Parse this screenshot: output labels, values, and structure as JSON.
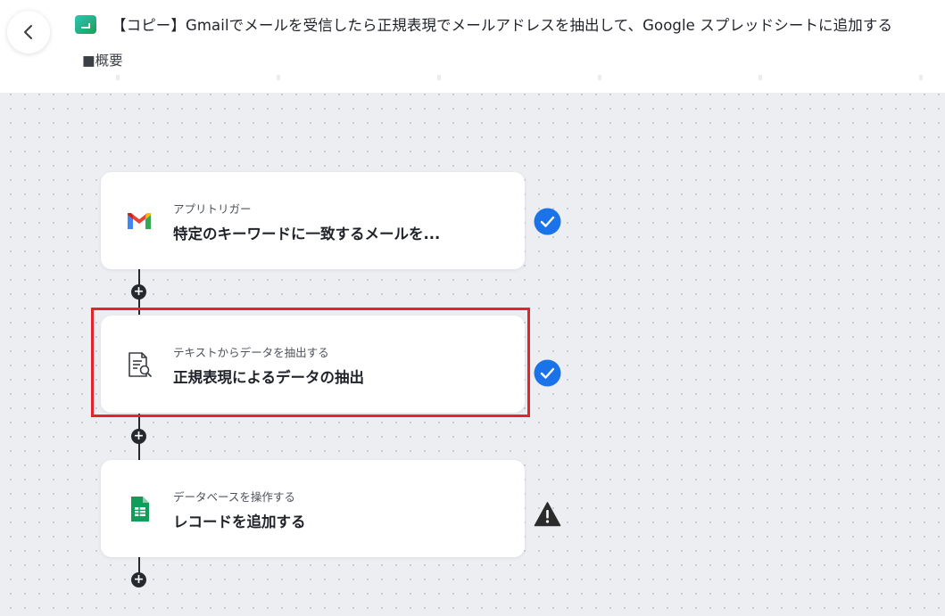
{
  "header": {
    "title": "【コピー】Gmailでメールを受信したら正規表現でメールアドレスを抽出して、Google スプレッドシートに追加する",
    "description": "■概要",
    "back_icon": "chevron-left-icon",
    "flow_icon": "flowbot-icon"
  },
  "steps": [
    {
      "category": "アプリトリガー",
      "title": "特定のキーワードに一致するメールを...",
      "icon": "gmail-icon",
      "status": "completed",
      "status_icon": "check-circle-icon"
    },
    {
      "category": "テキストからデータを抽出する",
      "title": "正規表現によるデータの抽出",
      "icon": "document-search-icon",
      "status": "completed",
      "status_icon": "check-circle-icon",
      "highlighted": true
    },
    {
      "category": "データベースを操作する",
      "title": "レコードを追加する",
      "icon": "google-sheets-icon",
      "status": "warning",
      "status_icon": "warning-triangle-icon"
    }
  ],
  "add_step_symbol": "+",
  "colors": {
    "check": "#1a73e8",
    "warning": "#2b2b2b",
    "highlight": "#e0262b",
    "connector": "#26292e"
  }
}
